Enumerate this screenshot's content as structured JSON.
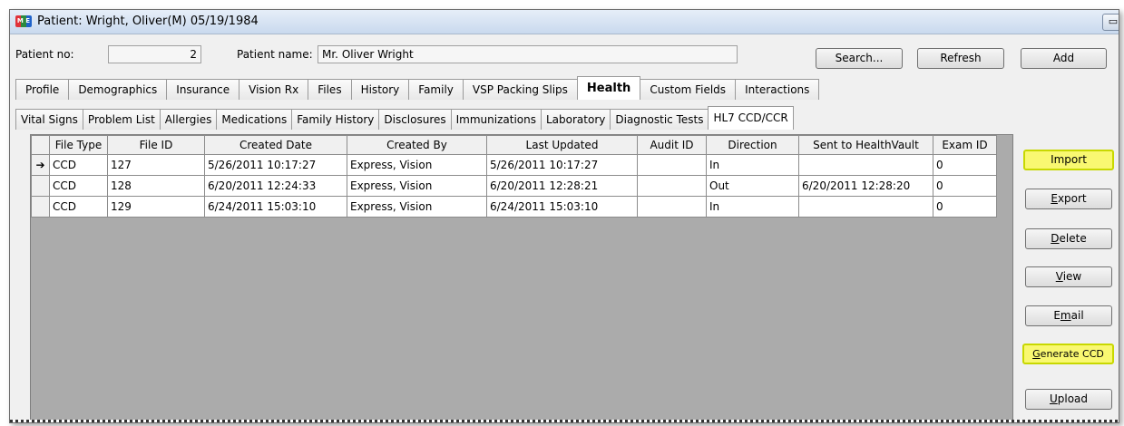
{
  "window": {
    "title": "Patient: Wright, Oliver(M) 05/19/1984",
    "icon_text": "M E"
  },
  "patient": {
    "no_label": "Patient no:",
    "no_value": "2",
    "name_label": "Patient name:",
    "name_value": "Mr. Oliver Wright"
  },
  "top_buttons": {
    "search": "Search...",
    "refresh": "Refresh",
    "add": "Add"
  },
  "main_tabs": [
    "Profile",
    "Demographics",
    "Insurance",
    "Vision Rx",
    "Files",
    "History",
    "Family",
    "VSP Packing Slips",
    "Health",
    "Custom Fields",
    "Interactions"
  ],
  "main_tab_active": "Health",
  "sub_tabs": [
    "Vital Signs",
    "Problem List",
    "Allergies",
    "Medications",
    "Family History",
    "Disclosures",
    "Immunizations",
    "Laboratory",
    "Diagnostic Tests",
    "HL7 CCD/CCR"
  ],
  "sub_tab_active": "HL7 CCD/CCR",
  "grid": {
    "columns": [
      "File Type",
      "File ID",
      "Created Date",
      "Created By",
      "Last Updated",
      "Audit ID",
      "Direction",
      "Sent to HealthVault",
      "Exam ID"
    ],
    "rows": [
      {
        "indicator": "➔",
        "file_type": "CCD",
        "file_id": "127",
        "created": "5/26/2011 10:17:27",
        "created_by": "Express, Vision",
        "updated": "5/26/2011 10:17:27",
        "audit_id": "",
        "direction": "In",
        "sent": "",
        "exam_id": "0"
      },
      {
        "indicator": "",
        "file_type": "CCD",
        "file_id": "128",
        "created": "6/20/2011 12:24:33",
        "created_by": "Express, Vision",
        "updated": "6/20/2011 12:28:21",
        "audit_id": "",
        "direction": "Out",
        "sent": "6/20/2011 12:28:20",
        "exam_id": "0"
      },
      {
        "indicator": "",
        "file_type": "CCD",
        "file_id": "129",
        "created": "6/24/2011 15:03:10",
        "created_by": "Express, Vision",
        "updated": "6/24/2011 15:03:10",
        "audit_id": "",
        "direction": "In",
        "sent": "",
        "exam_id": "0"
      }
    ]
  },
  "side_buttons": {
    "import": "Import",
    "export": "Export",
    "delete": "Delete",
    "view": "View",
    "email": "Email",
    "generate": "Generate CCD",
    "upload": "Upload"
  },
  "colors": {
    "highlight": "#f9f871",
    "highlight_border": "#c8d800"
  }
}
